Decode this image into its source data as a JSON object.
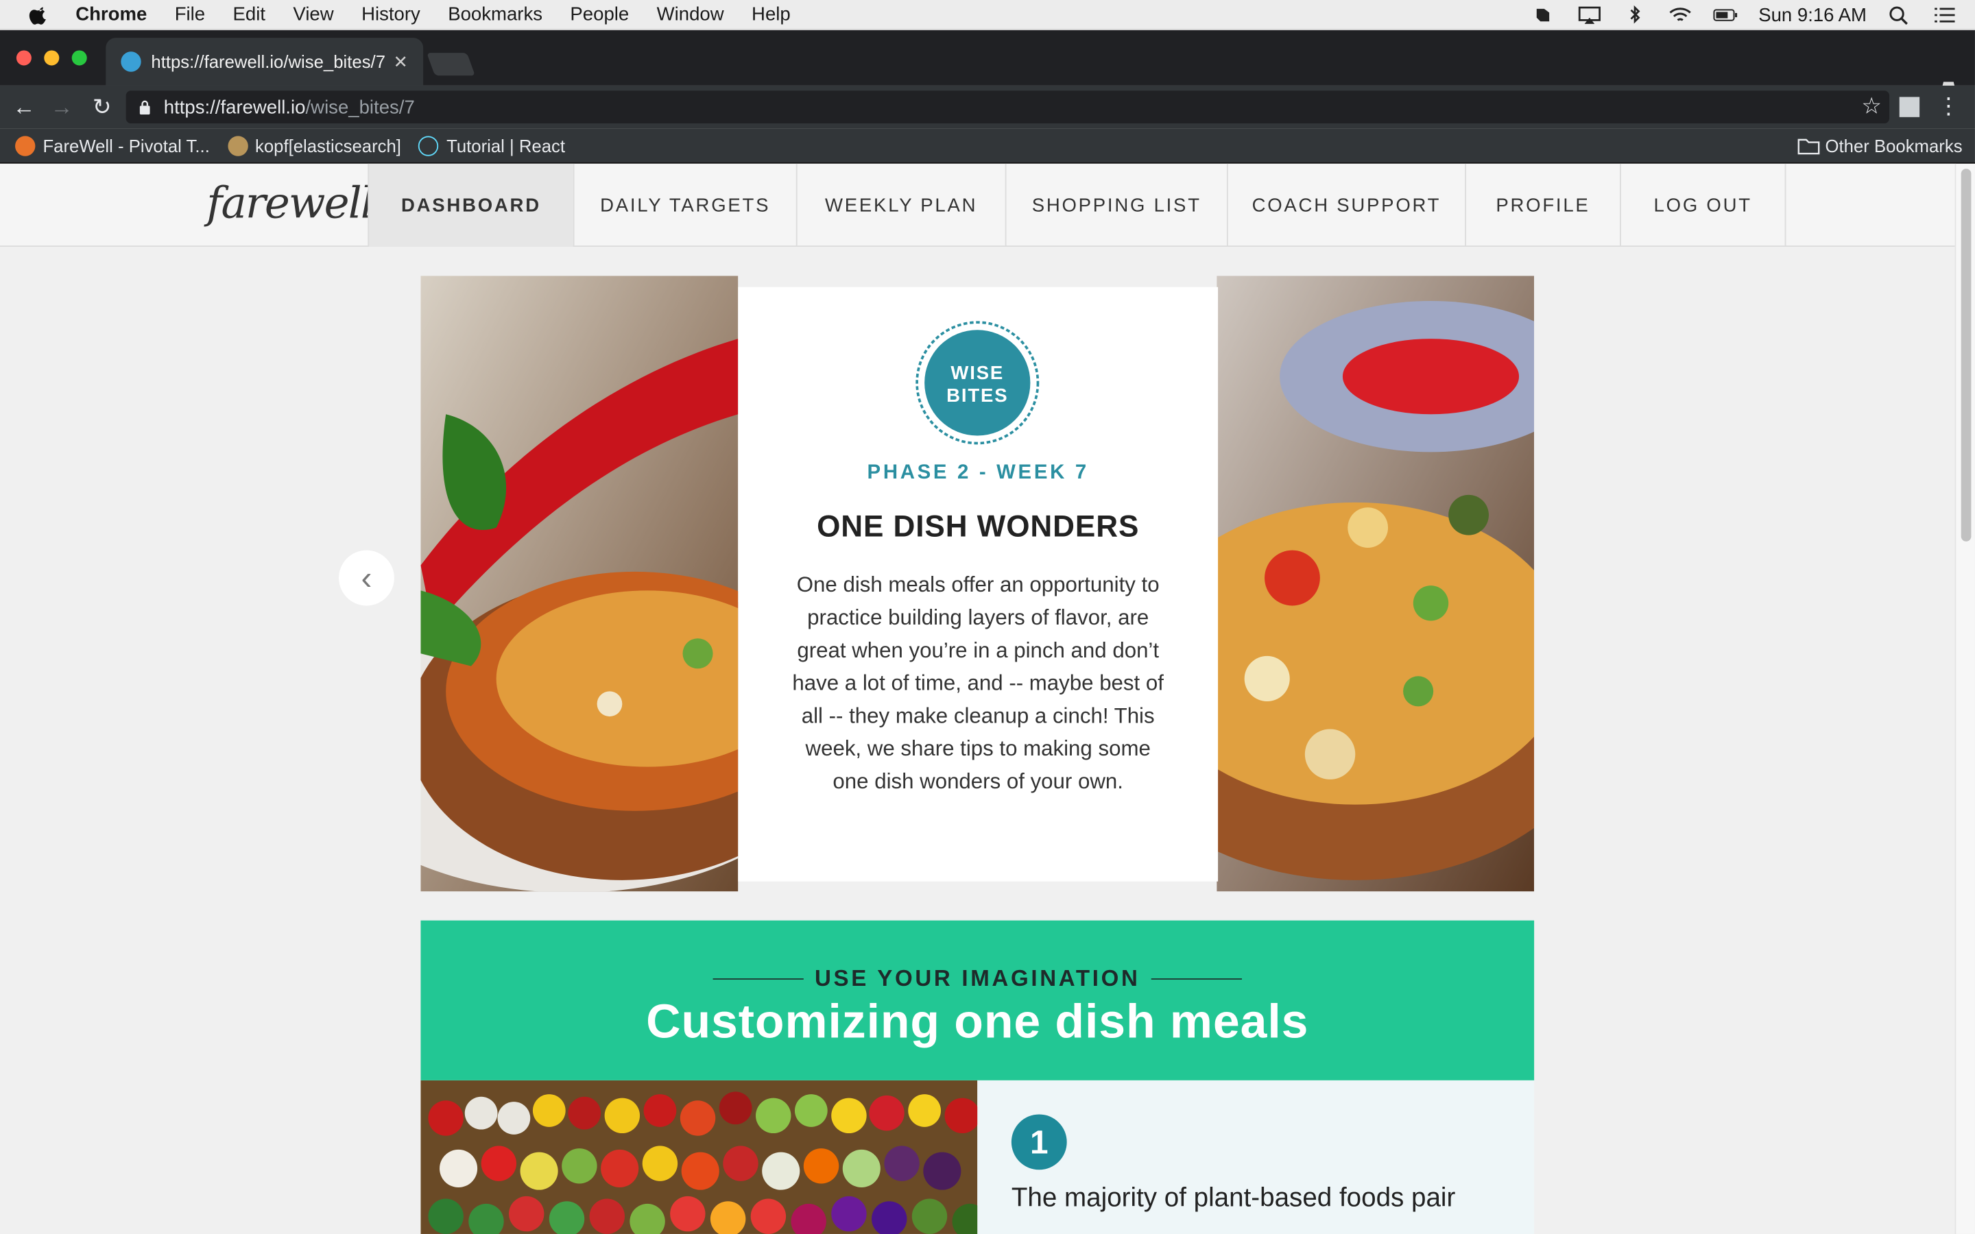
{
  "menubar": {
    "app": "Chrome",
    "items": [
      "File",
      "Edit",
      "View",
      "History",
      "Bookmarks",
      "People",
      "Window",
      "Help"
    ],
    "clock": "Sun 9:16 AM"
  },
  "tab": {
    "title": "https://farewell.io/wise_bites/7"
  },
  "omnibox": {
    "url_host": "https://farewell.io",
    "url_path": "/wise_bites/7"
  },
  "bookmarks": {
    "items": [
      "FareWell - Pivotal T...",
      "kopf[elasticsearch]",
      "Tutorial | React"
    ],
    "other": "Other Bookmarks"
  },
  "site": {
    "logo": "farewell",
    "nav": [
      "DASHBOARD",
      "DAILY TARGETS",
      "WEEKLY PLAN",
      "SHOPPING LIST",
      "COACH SUPPORT",
      "PROFILE",
      "LOG OUT"
    ]
  },
  "hero": {
    "badge_line1": "WISE",
    "badge_line2": "BITES",
    "phase": "PHASE 2 - WEEK 7",
    "title": "ONE DISH WONDERS",
    "body": "One dish meals offer an opportunity to practice building layers of flavor, are great when you’re in a pinch and don’t have a lot of time, and -- maybe best of all -- they make cleanup a cinch! This week, we share tips to making some one dish wonders of your own."
  },
  "section": {
    "eyebrow": "USE YOUR IMAGINATION",
    "title": "Customizing one dish meals"
  },
  "tip": {
    "number": "1",
    "text": "The majority of plant-based foods pair"
  },
  "colors": {
    "teal": "#2b8fa1",
    "green": "#22c794",
    "tip_bg": "#eef6f8"
  }
}
